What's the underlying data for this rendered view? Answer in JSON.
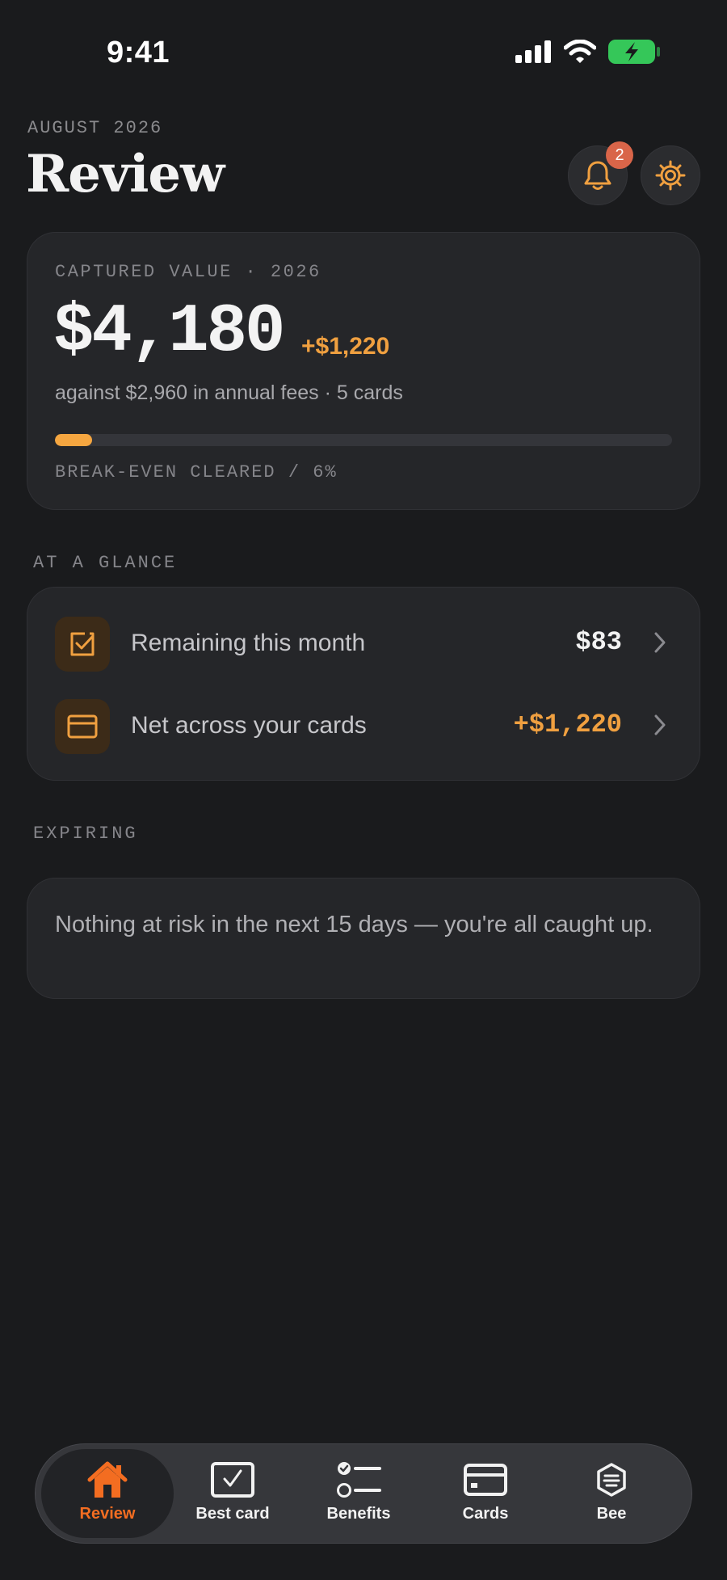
{
  "status_bar": {
    "time": "9:41",
    "icons": [
      "signal-icon",
      "wifi-icon",
      "battery-charging-icon"
    ],
    "battery_color": "#35c759"
  },
  "header": {
    "month": "AUGUST 2026",
    "title": "Review",
    "notifications_count": "2",
    "actions": [
      "bell-icon",
      "gear-icon"
    ]
  },
  "captured": {
    "eyebrow": "CAPTURED VALUE · 2026",
    "amount": "$4,180",
    "delta": "+$1,220",
    "subtitle": "against $2,960 in annual fees · 5 cards",
    "progress_percent": 6,
    "footer": "BREAK-EVEN CLEARED / 6%"
  },
  "glance": {
    "label": "AT A GLANCE",
    "rows": [
      {
        "icon": "checkbox-icon",
        "label": "Remaining this month",
        "value": "$83"
      },
      {
        "icon": "card-icon",
        "label": "Net across your cards",
        "value": "+$1,220"
      }
    ]
  },
  "expiring": {
    "label": "EXPIRING",
    "message": "Nothing at risk in the next 15 days — you're all caught up."
  },
  "tabs": [
    {
      "label": "Review",
      "icon": "home-icon",
      "active": true
    },
    {
      "label": "Best card",
      "icon": "check-square-icon",
      "active": false
    },
    {
      "label": "Benefits",
      "icon": "checklist-icon",
      "active": false
    },
    {
      "label": "Cards",
      "icon": "credit-card-icon",
      "active": false
    },
    {
      "label": "Bee",
      "icon": "bee-icon",
      "active": false
    }
  ],
  "colors": {
    "accent": "#f0a040",
    "active_tab": "#f36d21",
    "badge": "#d96549",
    "background": "#1a1b1d"
  }
}
